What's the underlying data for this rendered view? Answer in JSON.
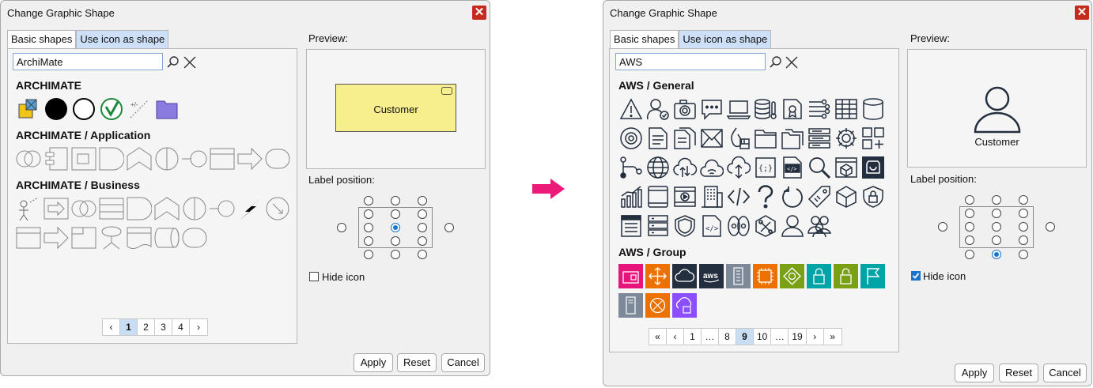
{
  "left": {
    "title": "Change Graphic Shape",
    "tabs": [
      "Basic shapes",
      "Use icon as shape"
    ],
    "search_value": "ArchiMate",
    "categories": [
      "ARCHIMATE",
      "ARCHIMATE / Application",
      "ARCHIMATE / Business"
    ],
    "pager": [
      "‹",
      "1",
      "2",
      "3",
      "4",
      "›"
    ],
    "preview_label": "Preview:",
    "preview_shape_text": "Customer",
    "label_position_label": "Label position:",
    "hide_icon_label": "Hide icon",
    "hide_icon_checked": false,
    "buttons": {
      "apply": "Apply",
      "reset": "Reset",
      "cancel": "Cancel"
    }
  },
  "right": {
    "title": "Change Graphic Shape",
    "tabs": [
      "Basic shapes",
      "Use icon as shape"
    ],
    "search_value": "AWS",
    "categories": [
      "AWS / General",
      "AWS / Group"
    ],
    "pager": [
      "«",
      "‹",
      "1",
      "…",
      "8",
      "9",
      "10",
      "…",
      "19",
      "›",
      "»"
    ],
    "preview_label": "Preview:",
    "preview_shape_text": "Customer",
    "label_position_label": "Label position:",
    "hide_icon_label": "Hide icon",
    "hide_icon_checked": true,
    "buttons": {
      "apply": "Apply",
      "reset": "Reset",
      "cancel": "Cancel"
    }
  },
  "colors": {
    "arrow": "#ec1b7a",
    "close": "#c42b1c",
    "selection": "#1a73c9",
    "preview_fill": "#f7ef8d",
    "aws_group": [
      "#e7157b",
      "#ed7100",
      "#232f3e",
      "#232f3e",
      "#7d8998",
      "#ed7100",
      "#7aa116",
      "#00a4a6",
      "#7aa116",
      "#00a4a6",
      "#7d8998",
      "#ed7100",
      "#8c4fff"
    ]
  }
}
